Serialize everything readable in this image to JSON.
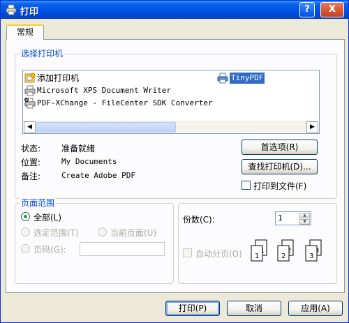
{
  "window": {
    "title": "打印",
    "help_label": "?",
    "close_label": "X"
  },
  "tabs": [
    {
      "label": "常规"
    }
  ],
  "printer_group": {
    "legend": "选择打印机",
    "printers": [
      {
        "label": "添加打印机",
        "icon": "add-printer-icon",
        "selected": false
      },
      {
        "label": "TinyPDF",
        "icon": "printer-icon",
        "selected": true
      },
      {
        "label": "Microsoft XPS Document Writer",
        "icon": "printer-icon",
        "selected": false
      },
      {
        "label": "PDF-XChange - FileCenter SDK Converter",
        "icon": "default-printer-icon",
        "selected": false
      }
    ],
    "scroll_left": "◀",
    "scroll_right": "▶",
    "status_label": "状态:",
    "status_value": "准备就绪",
    "location_label": "位置:",
    "location_value": "My Documents",
    "comment_label": "备注:",
    "comment_value": "Create Adobe PDF",
    "preferences_button": "首选项(R)",
    "find_printer_button": "查找打印机(D)...",
    "print_to_file_label": "打印到文件(F)",
    "print_to_file_checked": false
  },
  "page_range": {
    "legend": "页面范围",
    "all_label": "全部(L)",
    "all_selected": true,
    "selection_label": "选定范围(T)",
    "current_page_label": "当前页面(U)",
    "pages_label": "页码(G):",
    "pages_value": ""
  },
  "copies": {
    "label": "份数(C):",
    "value": "1",
    "collate_label": "自动分页(O)",
    "collate_checked": false,
    "collate_pages": [
      "1",
      "1",
      "2",
      "2",
      "3",
      "3"
    ]
  },
  "footer": {
    "print_button": "打印(P)",
    "cancel_button": "取消",
    "apply_button": "应用(A)"
  },
  "colors": {
    "titlebar": "#0055E5",
    "dialog_bg": "#ECE9D8",
    "selection": "#316AC5",
    "legend_text": "#0046D5"
  }
}
